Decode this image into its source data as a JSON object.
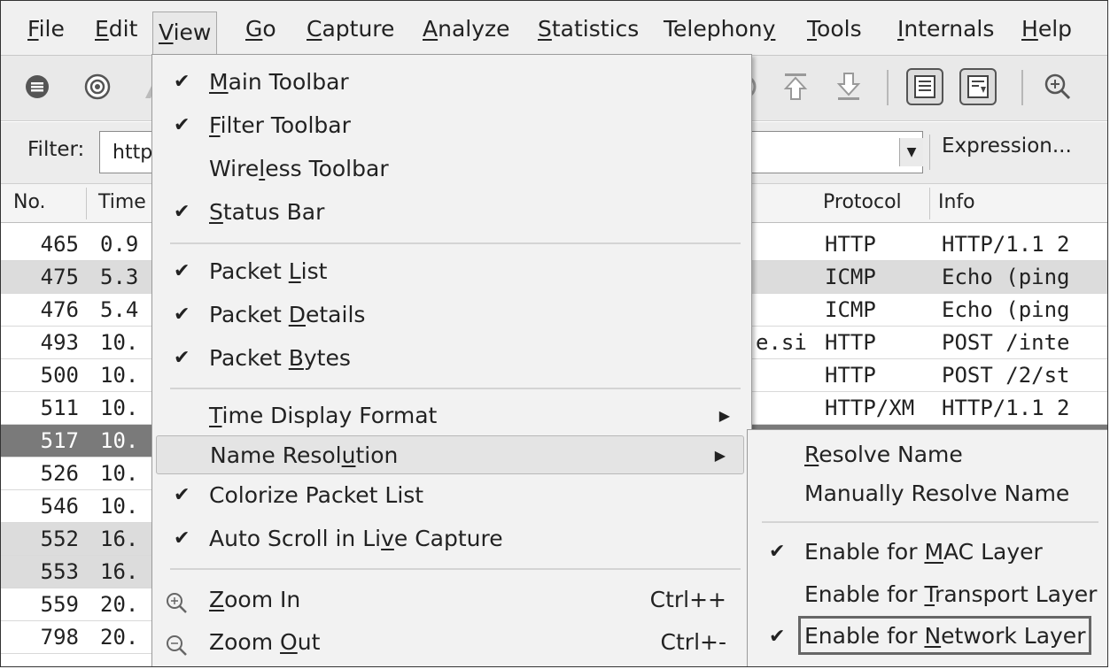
{
  "menubar": {
    "items": [
      {
        "pre": "",
        "u": "F",
        "post": "ile"
      },
      {
        "pre": "",
        "u": "E",
        "post": "dit"
      },
      {
        "pre": "",
        "u": "V",
        "post": "iew"
      },
      {
        "pre": "",
        "u": "G",
        "post": "o"
      },
      {
        "pre": "",
        "u": "C",
        "post": "apture"
      },
      {
        "pre": "",
        "u": "A",
        "post": "nalyze"
      },
      {
        "pre": "",
        "u": "S",
        "post": "tatistics"
      },
      {
        "pre": "Telephon",
        "u": "y",
        "post": ""
      },
      {
        "pre": "",
        "u": "T",
        "post": "ools"
      },
      {
        "pre": "",
        "u": "I",
        "post": "nternals"
      },
      {
        "pre": "",
        "u": "H",
        "post": "elp"
      }
    ]
  },
  "filter": {
    "label": "Filter:",
    "value": "http",
    "expression_label": "Expression..."
  },
  "packet_list": {
    "headers": {
      "no": "No.",
      "time": "Time",
      "protocol": "Protocol",
      "info": "Info"
    },
    "rows": [
      {
        "no": "465",
        "time": "0.9",
        "protocol": "HTTP",
        "info": "HTTP/1.1 2",
        "extra": ""
      },
      {
        "no": "475",
        "time": "5.3",
        "protocol": "ICMP",
        "info": "Echo (ping",
        "extra": ""
      },
      {
        "no": "476",
        "time": "5.4",
        "protocol": "ICMP",
        "info": "Echo (ping",
        "extra": ""
      },
      {
        "no": "493",
        "time": "10.",
        "protocol": "HTTP",
        "info": "POST /inte",
        "extra": "e.si"
      },
      {
        "no": "500",
        "time": "10.",
        "protocol": "HTTP",
        "info": "POST /2/st",
        "extra": ""
      },
      {
        "no": "511",
        "time": "10.",
        "protocol": "HTTP/XM",
        "info": "HTTP/1.1 2",
        "extra": ""
      },
      {
        "no": "517",
        "time": "10.",
        "protocol": "",
        "info": "",
        "extra": ""
      },
      {
        "no": "526",
        "time": "10.",
        "protocol": "",
        "info": "",
        "extra": ""
      },
      {
        "no": "546",
        "time": "10.",
        "protocol": "",
        "info": "",
        "extra": ""
      },
      {
        "no": "552",
        "time": "16.",
        "protocol": "",
        "info": "",
        "extra": ""
      },
      {
        "no": "553",
        "time": "16.",
        "protocol": "",
        "info": "",
        "extra": ""
      },
      {
        "no": "559",
        "time": "20.",
        "protocol": "",
        "info": "",
        "extra": ""
      },
      {
        "no": "798",
        "time": "20.",
        "protocol": "",
        "info": "",
        "extra": ""
      }
    ]
  },
  "view_menu": {
    "items": [
      {
        "checked": true,
        "pre": "",
        "u": "M",
        "post": "ain Toolbar"
      },
      {
        "checked": true,
        "pre": "",
        "u": "F",
        "post": "ilter Toolbar"
      },
      {
        "checked": false,
        "pre": "Wire",
        "u": "l",
        "post": "ess Toolbar"
      },
      {
        "checked": true,
        "pre": "",
        "u": "S",
        "post": "tatus Bar"
      },
      {
        "checked": true,
        "pre": "Packet ",
        "u": "L",
        "post": "ist"
      },
      {
        "checked": true,
        "pre": "Packet ",
        "u": "D",
        "post": "etails"
      },
      {
        "checked": true,
        "pre": "Packet ",
        "u": "B",
        "post": "ytes"
      },
      {
        "checked": false,
        "pre": "",
        "u": "T",
        "post": "ime Display Format"
      },
      {
        "checked": false,
        "pre": "Name Resol",
        "u": "u",
        "post": "tion"
      },
      {
        "checked": true,
        "pre": "Colorize Packet List",
        "u": "",
        "post": ""
      },
      {
        "checked": true,
        "pre": "Auto Scroll in Li",
        "u": "v",
        "post": "e Capture"
      },
      {
        "checked": false,
        "pre": "",
        "u": "Z",
        "post": "oom In",
        "shortcut": "Ctrl++"
      },
      {
        "checked": false,
        "pre": "Zoom ",
        "u": "O",
        "post": "ut",
        "shortcut": "Ctrl+-"
      }
    ]
  },
  "name_resolution_submenu": {
    "items": [
      {
        "checked": false,
        "pre": "",
        "u": "R",
        "post": "esolve Name"
      },
      {
        "checked": false,
        "pre": "Manually Resolve Name",
        "u": "",
        "post": ""
      },
      {
        "checked": true,
        "pre": "Enable for ",
        "u": "M",
        "post": "AC Layer"
      },
      {
        "checked": false,
        "pre": "Enable for ",
        "u": "T",
        "post": "ransport Layer"
      },
      {
        "checked": true,
        "pre": "Enable for ",
        "u": "N",
        "post": "etwork Layer"
      }
    ]
  },
  "colors": {
    "menu_bg": "#f2f2f2",
    "selected_row": "#7a7a7a",
    "shaded_row": "#d8d8d8"
  }
}
